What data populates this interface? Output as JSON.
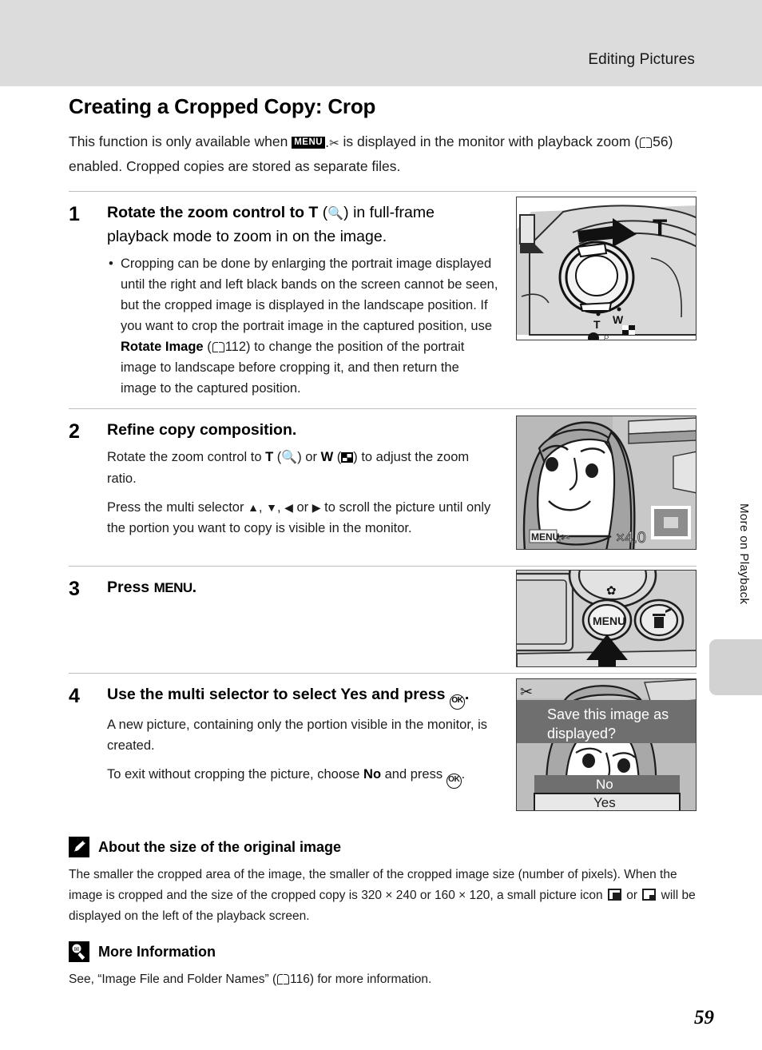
{
  "header": {
    "section_title": "Editing Pictures"
  },
  "side_tab": {
    "label": "More on Playback"
  },
  "page": {
    "title": "Creating a Cropped Copy: Crop",
    "number": "59",
    "intro_part1": "This function is only available when ",
    "intro_menu_badge": "MENU",
    "intro_part2": " is displayed in the monitor with playback zoom (",
    "intro_page_ref": "56",
    "intro_part3": ") enabled. Cropped copies are stored as separate files."
  },
  "steps": [
    {
      "number": "1",
      "heading_a": "Rotate the zoom control to ",
      "heading_T": "T",
      "heading_b": " (",
      "heading_c": ") in full-frame playback mode to zoom in on the image.",
      "bullet_a": "Cropping can be done by enlarging the portrait image displayed until the right and left black bands on the screen cannot be seen, but the cropped image is displayed in the landscape position. If you want to crop the portrait image in the captured position, use ",
      "bullet_bold": "Rotate Image",
      "bullet_b": " (",
      "bullet_page_ref": "112",
      "bullet_c": ") to change the position of the portrait image to landscape before cropping it, and then return the image to the captured position.",
      "figure": {
        "name": "camera-zoom-control",
        "arrow_label": "T",
        "marks": [
          "T",
          "W"
        ]
      }
    },
    {
      "number": "2",
      "heading": "Refine copy composition.",
      "para1_a": "Rotate the zoom control to ",
      "para1_T": "T",
      "para1_b": " (",
      "para1_c": ") or ",
      "para1_W": "W",
      "para1_d": " (",
      "para1_e": ") to adjust the zoom ratio.",
      "para2_a": "Press the multi selector ",
      "para2_b": ", ",
      "para2_c": ", ",
      "para2_d": " or ",
      "para2_e": " to scroll the picture until only the portion you want to copy is visible in the monitor.",
      "figure": {
        "name": "monitor-zoomed-portrait",
        "menu_badge": "MENU",
        "zoom_ratio": "×4.0"
      }
    },
    {
      "number": "3",
      "heading_a": "Press ",
      "heading_menu": "MENU",
      "heading_b": ".",
      "figure": {
        "name": "camera-back-menu-button",
        "menu_button_label": "MENU"
      }
    },
    {
      "number": "4",
      "heading_a": "Use the multi selector to select ",
      "heading_yes": "Yes",
      "heading_b": " and press ",
      "heading_c": ".",
      "para1": "A new picture, containing only the portion visible in the monitor, is created.",
      "para2_a": "To exit without cropping the picture, choose ",
      "para2_no": "No",
      "para2_b": " and press ",
      "para2_c": ".",
      "figure": {
        "name": "monitor-save-dialog",
        "dialog_text": "Save this image as displayed?",
        "option_no": "No",
        "option_yes": "Yes"
      }
    }
  ],
  "notes": [
    {
      "icon": "pencil-icon",
      "title": "About the size of the original image",
      "text_a": "The smaller the cropped area of the image, the smaller of the cropped image size (number of pixels). When the image is cropped and the size of the cropped copy is 320 × 240 or 160 × 120, a small picture icon ",
      "text_b": " or ",
      "text_c": " will be displayed on the left of the playback screen."
    },
    {
      "icon": "tip-bulb-icon",
      "title": "More Information",
      "text_a": "See, “Image File and Folder Names” (",
      "page_ref": "116",
      "text_b": ") for more information."
    }
  ],
  "colors": {
    "header_band": "#dcdcdc",
    "side_tab": "#d2d2d2",
    "rule": "#bdbdbd",
    "text": "#1c1c1c"
  }
}
